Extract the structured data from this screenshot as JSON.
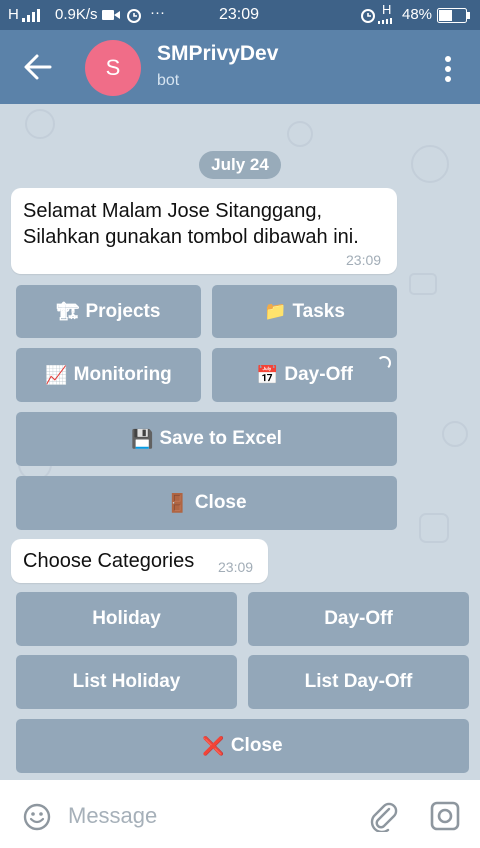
{
  "status_bar": {
    "signal_left": "H",
    "speed": "0.9K/s",
    "more": "···",
    "time": "23:09",
    "network": "H",
    "battery": "48%"
  },
  "header": {
    "avatar_letter": "S",
    "title": "SMPrivyDev",
    "subtitle": "bot"
  },
  "chat": {
    "date": "July 24",
    "message1": {
      "text": "Selamat Malam Jose Sitanggang,\nSilahkan gunakan tombol dibawah ini.",
      "time": "23:09"
    },
    "keyboard1": [
      {
        "emoji": "🏗",
        "label": "Projects"
      },
      {
        "emoji": "📁",
        "label": "Tasks"
      },
      {
        "emoji": "📈",
        "label": "Monitoring"
      },
      {
        "emoji": "📅",
        "label": "Day-Off"
      },
      {
        "emoji": "💾",
        "label": "Save to Excel"
      },
      {
        "emoji": "🚪",
        "label": "Close"
      }
    ],
    "message2": {
      "text": "Choose Categories",
      "time": "23:09"
    },
    "keyboard2": [
      {
        "label": "Holiday"
      },
      {
        "label": "Day-Off"
      },
      {
        "label": "List Holiday"
      },
      {
        "label": "List Day-Off"
      },
      {
        "emoji": "❌",
        "label": "Close"
      }
    ]
  },
  "input": {
    "placeholder": "Message"
  },
  "colors": {
    "header": "#5b82a9",
    "status_bar": "#3e6288",
    "avatar": "#f06d88",
    "chat_bg": "#cdd8e1",
    "keyboard_button": "#93a7b9"
  }
}
